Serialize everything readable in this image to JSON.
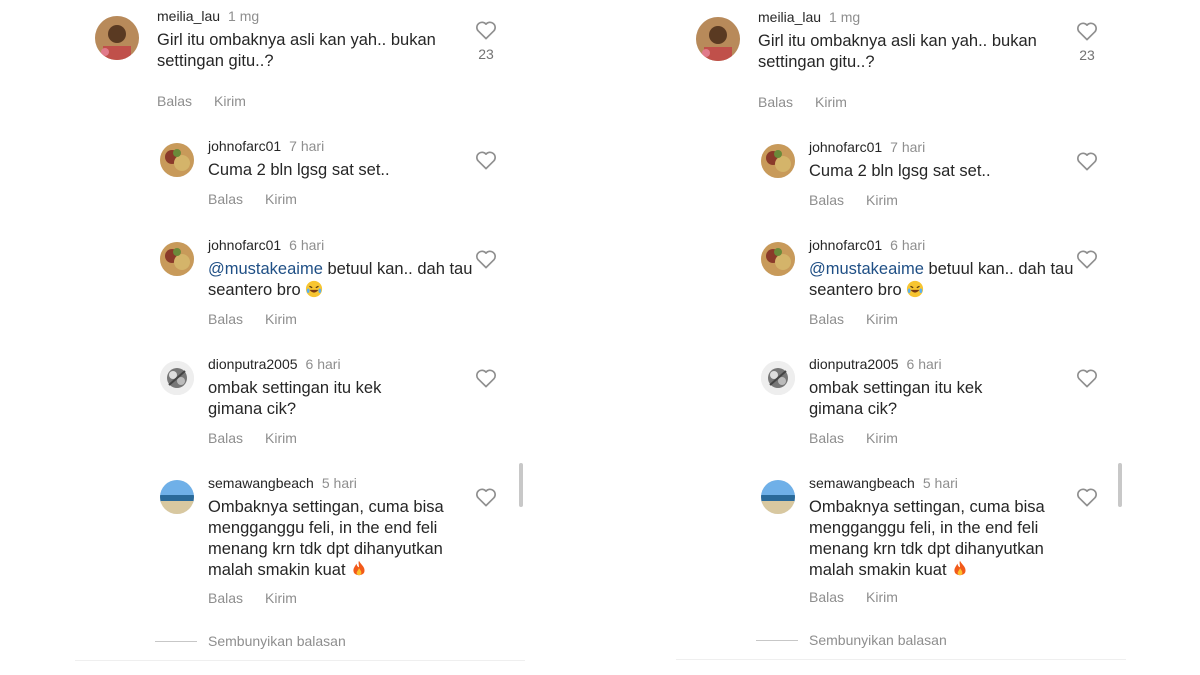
{
  "comment": {
    "username": "meilia_lau",
    "time": "1 mg",
    "text": "Girl itu ombaknya asli kan yah.. bukan settingan gitu..?",
    "likes": "23",
    "reply_label": "Balas",
    "send_label": "Kirim"
  },
  "replies": [
    {
      "username": "johnofarc01",
      "time": "7 hari",
      "text": "Cuma 2 bln lgsg sat set..",
      "reply_label": "Balas",
      "send_label": "Kirim"
    },
    {
      "username": "johnofarc01",
      "time": "6 hari",
      "mention": "@mustakeaime",
      "text": " betuul kan.. dah tau seantero bro ",
      "emoji": "rolling-laughing-emoji",
      "reply_label": "Balas",
      "send_label": "Kirim"
    },
    {
      "username": "dionputra2005",
      "time": "6 hari",
      "text": "ombak settingan itu kek gimana cik?",
      "reply_label": "Balas",
      "send_label": "Kirim"
    },
    {
      "username": "semawangbeach",
      "time": "5 hari",
      "text": "Ombaknya settingan, cuma bisa mengganggu feli, in the end feli menang krn tdk dpt dihanyutkan malah smakin kuat ",
      "emoji": "fire-emoji",
      "reply_label": "Balas",
      "send_label": "Kirim"
    }
  ],
  "hide_replies_label": "Sembunyikan balasan",
  "colors": {
    "mention": "#1f4f85",
    "meta": "#8e8e8e",
    "text": "#262626"
  }
}
